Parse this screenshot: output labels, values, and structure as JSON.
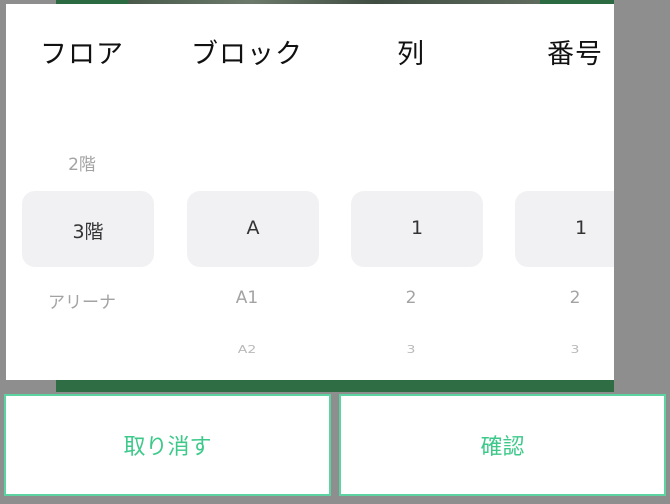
{
  "picker": {
    "columns": [
      {
        "header": "フロア",
        "prev": "2階",
        "selected": "3階",
        "next": "アリーナ",
        "next2": ""
      },
      {
        "header": "ブロック",
        "prev": "",
        "selected": "A",
        "next": "A1",
        "next2": "A2"
      },
      {
        "header": "列",
        "prev": "",
        "selected": "1",
        "next": "2",
        "next2": "3"
      },
      {
        "header": "番号",
        "prev": "",
        "selected": "1",
        "next": "2",
        "next2": "3"
      }
    ]
  },
  "actions": {
    "cancel_label": "取り消す",
    "confirm_label": "確認"
  },
  "colors": {
    "accent": "#3dc98a",
    "accent_border": "#5cd3a0",
    "backdrop": "#8e8e8e",
    "background_green": "#2c6a42"
  }
}
